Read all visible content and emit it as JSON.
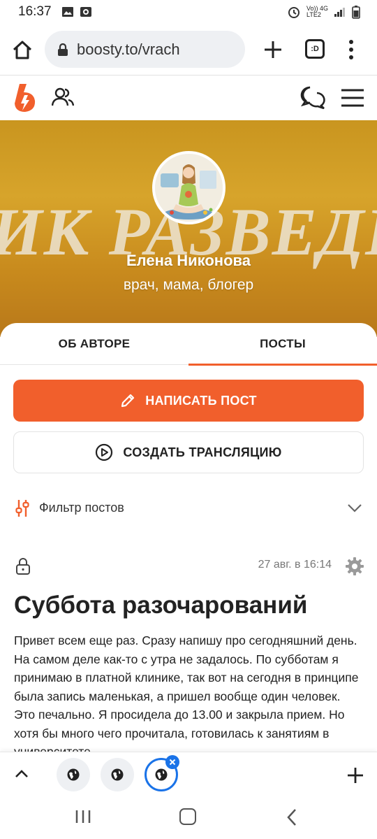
{
  "status_bar": {
    "time": "16:37",
    "network_top": "Vo)) 4G",
    "network_bottom": "LTE2"
  },
  "browser": {
    "url": "boosty.to/vrach",
    "tabs_icon_label": ":D"
  },
  "cover": {
    "background_text": "ИК РАЗВЕДЕ",
    "author_name": "Елена Никонова",
    "author_description": "врач, мама, блогер"
  },
  "tabs": [
    {
      "label": "ОБ АВТОРЕ",
      "active": false
    },
    {
      "label": "ПОСТЫ",
      "active": true
    }
  ],
  "actions": {
    "write_post": "НАПИСАТЬ ПОСТ",
    "create_stream": "СОЗДАТЬ ТРАНСЛЯЦИЮ"
  },
  "filter": {
    "label": "Фильтр постов"
  },
  "post": {
    "date": "27 авг. в 16:14",
    "title": "Суббота разочарований",
    "body": "Привет всем еще раз. Сразу напишу про сегодняшний день. На самом деле как-то с утра не задалось. По субботам я принимаю в платной клинике, так вот на сегодня в принципе была запись маленькая, а пришел вообще один человек. Это печально. Я просидела до 13.00 и закрыла прием. Но хотя бы много чего прочитала, готовилась к занятиям в университете"
  },
  "colors": {
    "accent": "#f15f2c",
    "browser_blue": "#1a73e8",
    "cover_gold": "#d7a42b"
  },
  "icons": [
    "home-icon",
    "lock-icon",
    "plus-icon",
    "tab-switcher-icon",
    "more-vert-icon",
    "boosty-logo",
    "people-icon",
    "chat-icon",
    "hamburger-menu-icon",
    "pencil-icon",
    "play-circle-icon",
    "filter-sliders-icon",
    "chevron-down-icon",
    "gear-icon",
    "globe-icon",
    "close-icon",
    "chevron-up-icon"
  ]
}
